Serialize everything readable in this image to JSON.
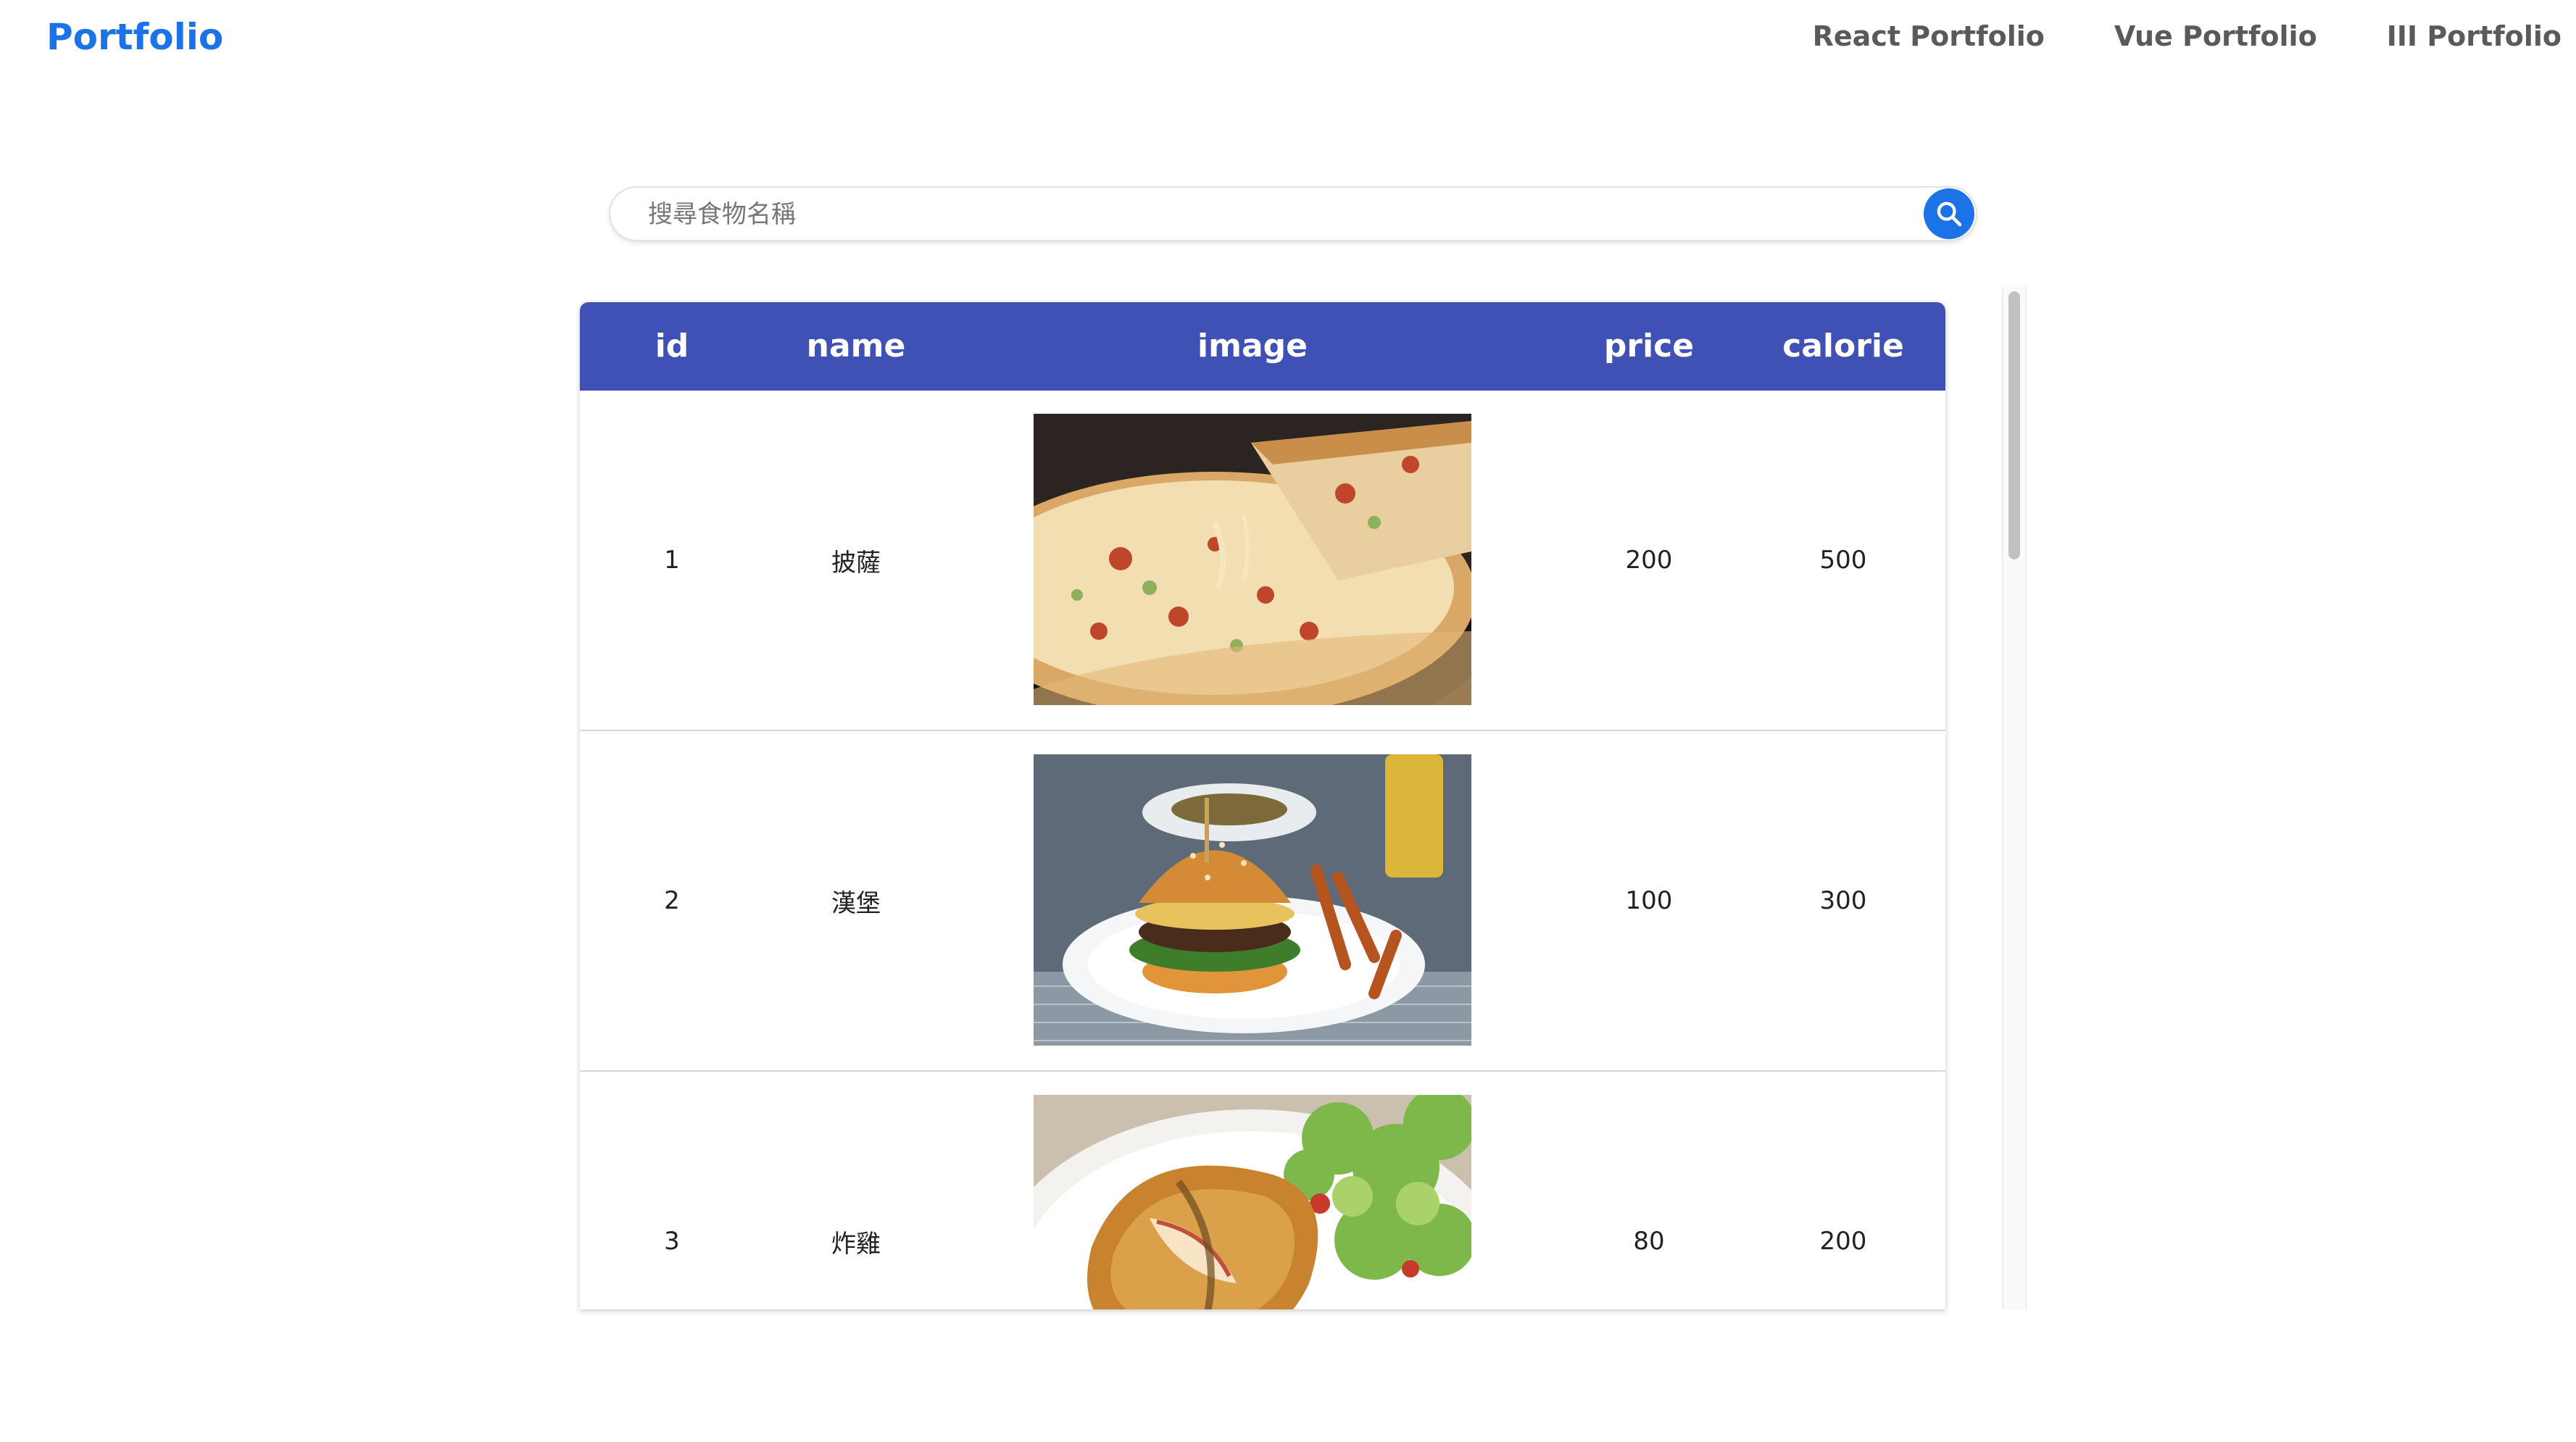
{
  "header": {
    "brand": "Portfolio",
    "nav": [
      "React Portfolio",
      "Vue Portfolio",
      "III Portfolio"
    ]
  },
  "search": {
    "placeholder": "搜尋食物名稱",
    "value": ""
  },
  "table": {
    "headers": [
      "id",
      "name",
      "image",
      "price",
      "calorie"
    ],
    "rows": [
      {
        "id": "1",
        "name": "披薩",
        "price": "200",
        "calorie": "500"
      },
      {
        "id": "2",
        "name": "漢堡",
        "price": "100",
        "calorie": "300"
      },
      {
        "id": "3",
        "name": "炸雞",
        "price": "80",
        "calorie": "200"
      }
    ]
  },
  "colors": {
    "brand": "#1c73e8",
    "table_header": "#3f51b5",
    "search_button": "#1c73e8"
  },
  "icons": {
    "search": "search-icon"
  }
}
